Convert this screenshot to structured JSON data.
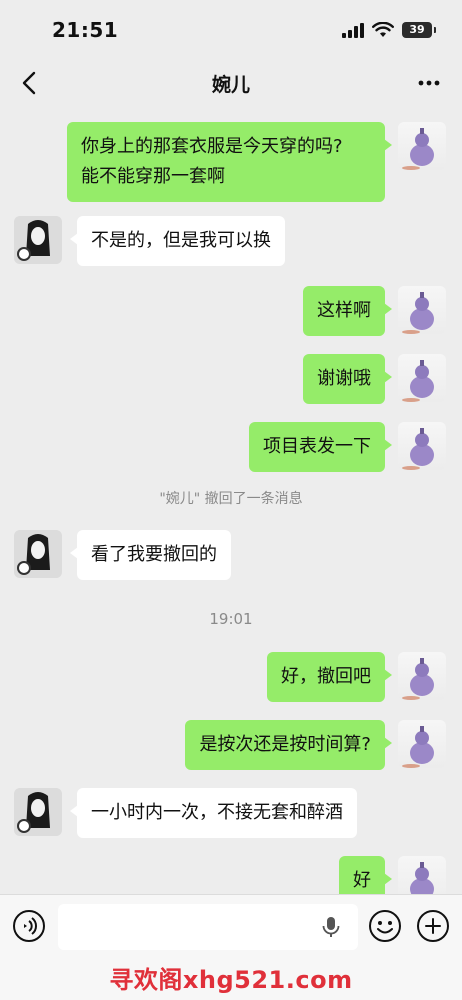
{
  "status": {
    "time": "21:51",
    "battery": "39"
  },
  "nav": {
    "title": "婉儿"
  },
  "messages": [
    {
      "from": "self",
      "lines": [
        "你身上的那套衣服是今天穿的吗?",
        "能不能穿那一套啊"
      ]
    },
    {
      "from": "other",
      "text": "不是的，但是我可以换"
    },
    {
      "from": "self",
      "text": "这样啊"
    },
    {
      "from": "self",
      "text": "谢谢哦"
    },
    {
      "from": "self",
      "text": "项目表发一下"
    },
    {
      "system": "\"婉儿\" 撤回了一条消息"
    },
    {
      "from": "other",
      "text": "看了我要撤回的"
    },
    {
      "timestamp": "19:01"
    },
    {
      "from": "self",
      "text": "好，撤回吧"
    },
    {
      "from": "self",
      "text": "是按次还是按时间算?"
    },
    {
      "from": "other",
      "text": "一小时内一次，不接无套和醉酒"
    },
    {
      "from": "self",
      "text": "好"
    }
  ],
  "input": {
    "value": ""
  },
  "watermark": "寻欢阁xhg521.com",
  "colors": {
    "self_bubble": "#95ec69",
    "other_bubble": "#ffffff",
    "background": "#ededed",
    "watermark": "#e0303a"
  },
  "icons": [
    "back-chevron-icon",
    "more-icon",
    "voice-icon",
    "mic-icon",
    "emoji-icon",
    "plus-icon",
    "wifi-icon",
    "signal-icon",
    "battery-icon"
  ]
}
